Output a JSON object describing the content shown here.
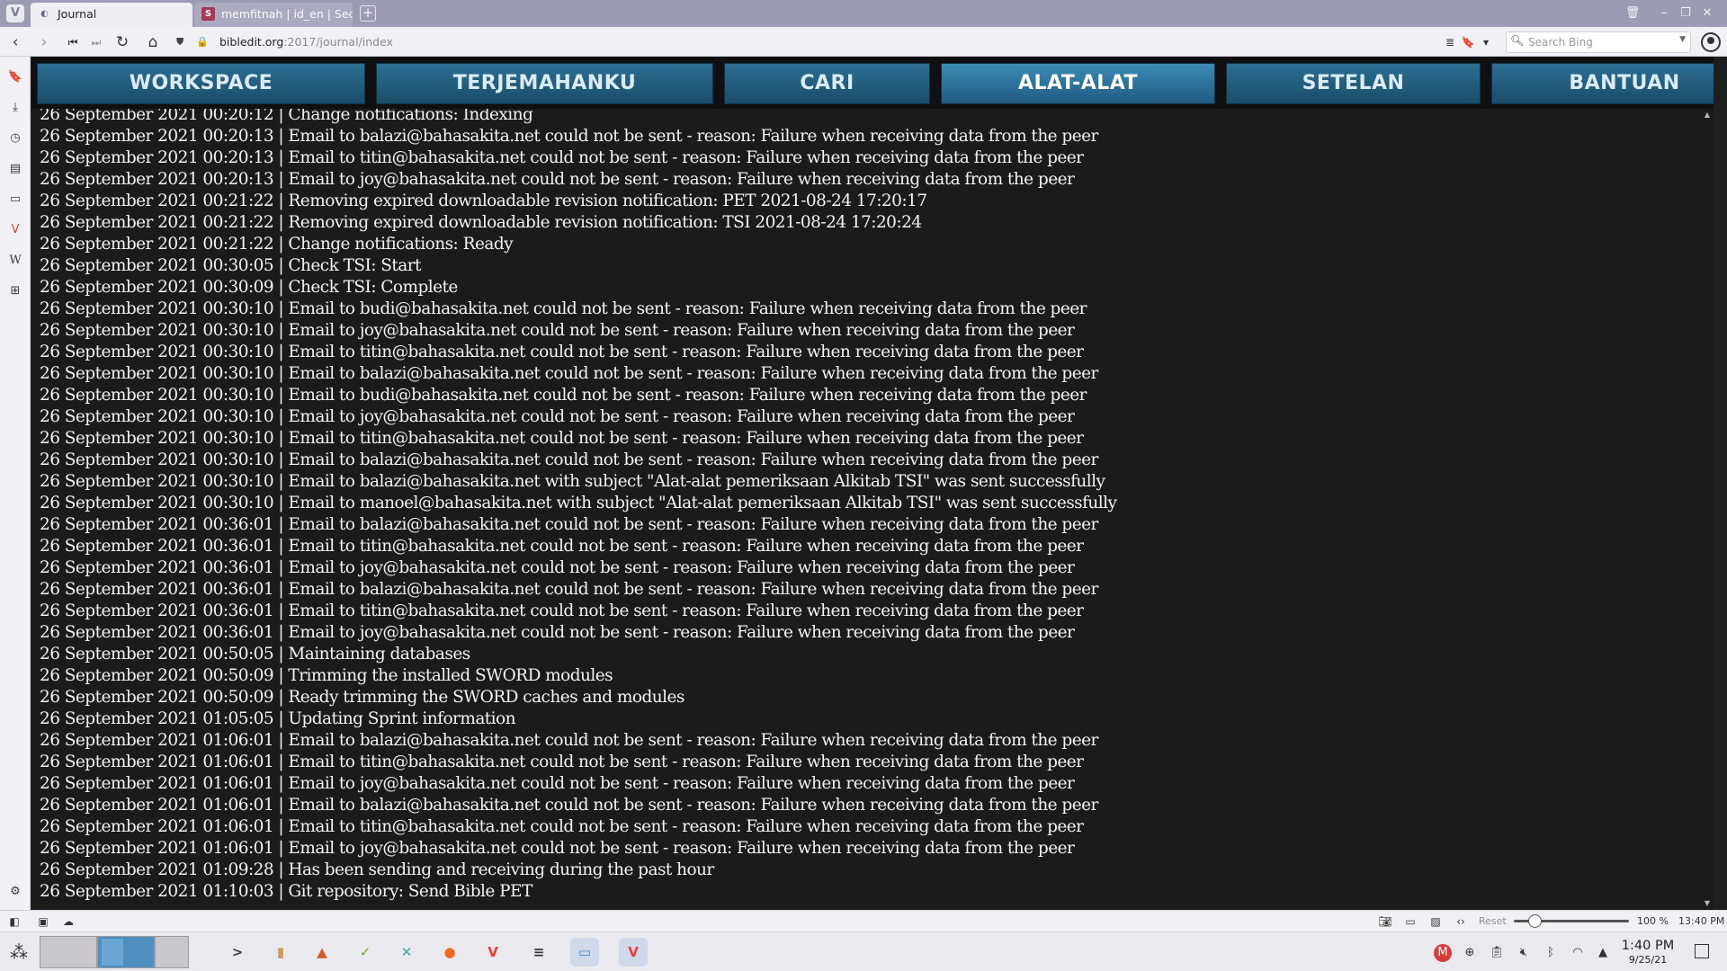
{
  "browser": {
    "menu_glyph": "V",
    "tabs": [
      {
        "title": "Journal",
        "icon": "globe-icon",
        "active": true
      },
      {
        "title": "memfitnah | id_en | Sederh",
        "icon": "site-favicon-icon",
        "favicon_glyph": "S",
        "active": false
      }
    ],
    "new_tab_glyph": "+",
    "url": {
      "host": "bibledit.org",
      "path": ":2017/journal/index"
    },
    "search": {
      "placeholder": "Search Bing"
    }
  },
  "app": {
    "menu": [
      {
        "label": "WORKSPACE",
        "active": false
      },
      {
        "label": "TERJEMAHANKU",
        "active": false
      },
      {
        "label": "CARI",
        "active": false
      },
      {
        "label": "ALAT-ALAT",
        "active": true
      },
      {
        "label": "SETELAN",
        "active": false
      },
      {
        "label": "BANTUAN",
        "active": false
      }
    ],
    "accent_color": "#2d6f93",
    "journal_lines": [
      "26 September 2021 00:20:12 | Change notifications: Indexing",
      "26 September 2021 00:20:13 | Email to balazi@bahasakita.net could not be sent - reason: Failure when receiving data from the peer",
      "26 September 2021 00:20:13 | Email to titin@bahasakita.net could not be sent - reason: Failure when receiving data from the peer",
      "26 September 2021 00:20:13 | Email to joy@bahasakita.net could not be sent - reason: Failure when receiving data from the peer",
      "26 September 2021 00:21:22 | Removing expired downloadable revision notification: PET 2021-08-24 17:20:17",
      "26 September 2021 00:21:22 | Removing expired downloadable revision notification: TSI 2021-08-24 17:20:24",
      "26 September 2021 00:21:22 | Change notifications: Ready",
      "26 September 2021 00:30:05 | Check TSI: Start",
      "26 September 2021 00:30:09 | Check TSI: Complete",
      "26 September 2021 00:30:10 | Email to budi@bahasakita.net could not be sent - reason: Failure when receiving data from the peer",
      "26 September 2021 00:30:10 | Email to joy@bahasakita.net could not be sent - reason: Failure when receiving data from the peer",
      "26 September 2021 00:30:10 | Email to titin@bahasakita.net could not be sent - reason: Failure when receiving data from the peer",
      "26 September 2021 00:30:10 | Email to balazi@bahasakita.net could not be sent - reason: Failure when receiving data from the peer",
      "26 September 2021 00:30:10 | Email to budi@bahasakita.net could not be sent - reason: Failure when receiving data from the peer",
      "26 September 2021 00:30:10 | Email to joy@bahasakita.net could not be sent - reason: Failure when receiving data from the peer",
      "26 September 2021 00:30:10 | Email to titin@bahasakita.net could not be sent - reason: Failure when receiving data from the peer",
      "26 September 2021 00:30:10 | Email to balazi@bahasakita.net could not be sent - reason: Failure when receiving data from the peer",
      "26 September 2021 00:30:10 | Email to balazi@bahasakita.net with subject \"Alat-alat pemeriksaan Alkitab TSI\" was sent successfully",
      "26 September 2021 00:30:10 | Email to manoel@bahasakita.net with subject \"Alat-alat pemeriksaan Alkitab TSI\" was sent successfully",
      "26 September 2021 00:36:01 | Email to balazi@bahasakita.net could not be sent - reason: Failure when receiving data from the peer",
      "26 September 2021 00:36:01 | Email to titin@bahasakita.net could not be sent - reason: Failure when receiving data from the peer",
      "26 September 2021 00:36:01 | Email to joy@bahasakita.net could not be sent - reason: Failure when receiving data from the peer",
      "26 September 2021 00:36:01 | Email to balazi@bahasakita.net could not be sent - reason: Failure when receiving data from the peer",
      "26 September 2021 00:36:01 | Email to titin@bahasakita.net could not be sent - reason: Failure when receiving data from the peer",
      "26 September 2021 00:36:01 | Email to joy@bahasakita.net could not be sent - reason: Failure when receiving data from the peer",
      "26 September 2021 00:50:05 | Maintaining databases",
      "26 September 2021 00:50:09 | Trimming the installed SWORD modules",
      "26 September 2021 00:50:09 | Ready trimming the SWORD caches and modules",
      "26 September 2021 01:05:05 | Updating Sprint information",
      "26 September 2021 01:06:01 | Email to balazi@bahasakita.net could not be sent - reason: Failure when receiving data from the peer",
      "26 September 2021 01:06:01 | Email to titin@bahasakita.net could not be sent - reason: Failure when receiving data from the peer",
      "26 September 2021 01:06:01 | Email to joy@bahasakita.net could not be sent - reason: Failure when receiving data from the peer",
      "26 September 2021 01:06:01 | Email to balazi@bahasakita.net could not be sent - reason: Failure when receiving data from the peer",
      "26 September 2021 01:06:01 | Email to titin@bahasakita.net could not be sent - reason: Failure when receiving data from the peer",
      "26 September 2021 01:06:01 | Email to joy@bahasakita.net could not be sent - reason: Failure when receiving data from the peer",
      "26 September 2021 01:09:28 | Has been sending and receiving during the past hour",
      "26 September 2021 01:10:03 | Git repository: Send Bible PET"
    ]
  },
  "statusbar": {
    "reset_label": "Reset",
    "zoom_value": "100 %",
    "zoom_fraction": 0.14,
    "clock": "13:40 PM"
  },
  "taskbar": {
    "apps": [
      {
        "name": "terminal-app-icon",
        "glyph": ">",
        "color": "#3b3f45"
      },
      {
        "name": "book-app-icon",
        "glyph": "▮",
        "color": "#c69a5a"
      },
      {
        "name": "mosaic-app-icon",
        "glyph": "▲",
        "color": "#d05a2a"
      },
      {
        "name": "leaf-app-icon",
        "glyph": "✓",
        "color": "#6eaa2e"
      },
      {
        "name": "cross-app-icon",
        "glyph": "✕",
        "color": "#33a99a"
      },
      {
        "name": "firefox-app-icon",
        "glyph": "●",
        "color": "#ec6a1e"
      },
      {
        "name": "vivaldi-app-icon",
        "glyph": "V",
        "color": "#ef3939"
      },
      {
        "name": "console-app-icon",
        "glyph": "≡",
        "color": "#2c3440"
      },
      {
        "name": "files-app-icon",
        "glyph": "▭",
        "color": "#3d86d4"
      },
      {
        "name": "vivaldi-active-app-icon",
        "glyph": "V",
        "color": "#ef3939"
      }
    ],
    "time": "1:40 PM",
    "date": "9/25/21"
  }
}
